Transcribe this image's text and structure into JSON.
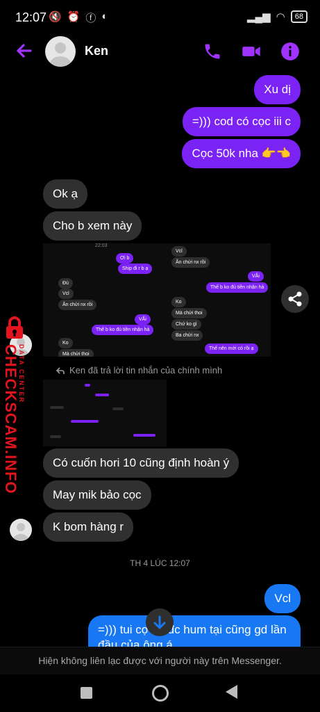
{
  "status_bar": {
    "time": "12:07",
    "battery": "68"
  },
  "header": {
    "contact_name": "Ken"
  },
  "messages_sent_1": [
    {
      "text": "Xu dị"
    },
    {
      "text": "=))) cod có cọc iii c"
    },
    {
      "text": "Cọc 50k nha 👉👈"
    }
  ],
  "messages_received_1": [
    {
      "text": "Ok ạ"
    },
    {
      "text": "Cho b xem này"
    }
  ],
  "screenshot_left": {
    "time": "22:03",
    "msgs": [
      "Ơi b",
      "Ship đi r b ạ",
      "Đù",
      "Vcl",
      "Ăn chửi nx rồi",
      "VÃi",
      "Thế b ko đủ tiền nhận hả",
      "Ko",
      "Mà chửi thoi"
    ]
  },
  "screenshot_right": {
    "msgs": [
      "Vcl",
      "Ăn chửi nx rồi",
      "VÃi",
      "Thế b ko đủ tiền nhận hả",
      "Ko",
      "Mà chửi thoi",
      "Chứ ko gì",
      "Ba chửi nx",
      "Thế nên mới có rồi ạ"
    ]
  },
  "reply_note": "Ken đã trả lời tin nhắn của chính mình",
  "messages_received_2": [
    {
      "text": "Có cuốn hori 10 cũng định hoàn ý"
    },
    {
      "text": "May mik bảo cọc"
    },
    {
      "text": "K bom hàng r"
    }
  ],
  "timestamp": "TH 4 LÚC 12:07",
  "messages_sent_2": [
    {
      "text": "Vcl"
    },
    {
      "text": "=))) tui cọ tín đc hum tại cũng gd lần đầu của ông á"
    }
  ],
  "footer_text": "Hiện không liên lạc được với người này trên Messenger.",
  "watermark": {
    "line1": "CHECKSCAM.INFO",
    "line2": "DATA CENTER"
  },
  "colors": {
    "accent": "#a033ff",
    "sent_bubble": "#7b22f4",
    "sent_blue": "#1877f2",
    "received_bubble": "#303030"
  }
}
